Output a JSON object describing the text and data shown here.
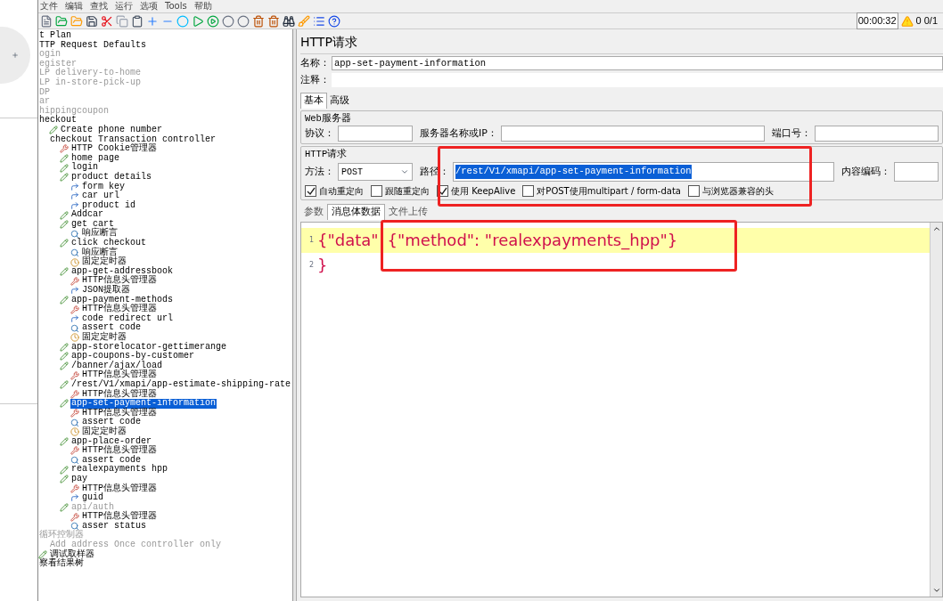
{
  "menu": [
    "文件",
    "编辑",
    "查找",
    "运行",
    "选项",
    "Tools",
    "帮助"
  ],
  "toolbar": {
    "elapsed": "00:00:32",
    "warnings": "0",
    "threads": "0/1"
  },
  "tree": [
    {
      "label": "t Plan",
      "kind": "plan",
      "disabled": false,
      "selected": false
    },
    {
      "label": "TTP Request Defaults",
      "kind": "plain",
      "disabled": false,
      "selected": false
    },
    {
      "label": "ogin",
      "kind": "plain",
      "disabled": true,
      "selected": false
    },
    {
      "label": "egister",
      "kind": "plain",
      "disabled": true,
      "selected": false
    },
    {
      "label": "LP delivery-to-home",
      "kind": "plain",
      "disabled": true,
      "selected": false
    },
    {
      "label": "LP in-store-pick-up",
      "kind": "plain",
      "disabled": true,
      "selected": false
    },
    {
      "label": "DP",
      "kind": "plain",
      "disabled": true,
      "selected": false
    },
    {
      "label": "ar",
      "kind": "plain",
      "disabled": true,
      "selected": false
    },
    {
      "label": "hippingcoupon",
      "kind": "plain",
      "disabled": true,
      "selected": false
    },
    {
      "label": "heckout",
      "kind": "plain",
      "disabled": false,
      "selected": false,
      "children": [
        {
          "label": "Create phone number",
          "kind": "sampler",
          "disabled": false,
          "selected": false
        },
        {
          "label": "checkout Transaction controller",
          "kind": "controller",
          "disabled": false,
          "selected": false,
          "children": [
            {
              "label": "HTTP Cookie管理器",
              "kind": "config",
              "disabled": false,
              "selected": false
            },
            {
              "label": "home page",
              "kind": "sampler",
              "disabled": false,
              "selected": false
            },
            {
              "label": "login",
              "kind": "sampler",
              "disabled": false,
              "selected": false
            },
            {
              "label": "product details",
              "kind": "sampler",
              "disabled": false,
              "selected": false,
              "children": [
                {
                  "label": "form key",
                  "kind": "extractor",
                  "disabled": false,
                  "selected": false
                },
                {
                  "label": "car url",
                  "kind": "extractor",
                  "disabled": false,
                  "selected": false
                },
                {
                  "label": "product id",
                  "kind": "extractor",
                  "disabled": false,
                  "selected": false
                }
              ]
            },
            {
              "label": "Addcar",
              "kind": "sampler",
              "disabled": false,
              "selected": false
            },
            {
              "label": "get cart",
              "kind": "sampler",
              "disabled": false,
              "selected": false,
              "children": [
                {
                  "label": "响应断言",
                  "kind": "assertion",
                  "disabled": false,
                  "selected": false
                }
              ]
            },
            {
              "label": "click checkout",
              "kind": "sampler",
              "disabled": false,
              "selected": false,
              "children": [
                {
                  "label": "响应断言",
                  "kind": "assertion",
                  "disabled": false,
                  "selected": false
                },
                {
                  "label": "固定定时器",
                  "kind": "timer",
                  "disabled": false,
                  "selected": false
                }
              ]
            },
            {
              "label": "app-get-addressbook",
              "kind": "sampler",
              "disabled": false,
              "selected": false,
              "children": [
                {
                  "label": "HTTP信息头管理器",
                  "kind": "config",
                  "disabled": false,
                  "selected": false
                },
                {
                  "label": "JSON提取器",
                  "kind": "extractor",
                  "disabled": false,
                  "selected": false
                }
              ]
            },
            {
              "label": "app-payment-methods",
              "kind": "sampler",
              "disabled": false,
              "selected": false,
              "children": [
                {
                  "label": "HTTP信息头管理器",
                  "kind": "config",
                  "disabled": false,
                  "selected": false
                },
                {
                  "label": "code redirect url",
                  "kind": "extractor",
                  "disabled": false,
                  "selected": false
                },
                {
                  "label": "assert code",
                  "kind": "assertion",
                  "disabled": false,
                  "selected": false
                },
                {
                  "label": "固定定时器",
                  "kind": "timer",
                  "disabled": false,
                  "selected": false
                }
              ]
            },
            {
              "label": "app-storelocator-gettimerange",
              "kind": "sampler",
              "disabled": false,
              "selected": false
            },
            {
              "label": "app-coupons-by-customer",
              "kind": "sampler",
              "disabled": false,
              "selected": false
            },
            {
              "label": "/banner/ajax/load",
              "kind": "sampler",
              "disabled": false,
              "selected": false,
              "children": [
                {
                  "label": "HTTP信息头管理器",
                  "kind": "config",
                  "disabled": false,
                  "selected": false
                }
              ]
            },
            {
              "label": "/rest/V1/xmapi/app-estimate-shipping-rate",
              "kind": "sampler",
              "disabled": false,
              "selected": false,
              "children": [
                {
                  "label": "HTTP信息头管理器",
                  "kind": "config",
                  "disabled": false,
                  "selected": false
                }
              ]
            },
            {
              "label": "app-set-payment-information",
              "kind": "sampler",
              "disabled": false,
              "selected": true,
              "children": [
                {
                  "label": "HTTP信息头管理器",
                  "kind": "config",
                  "disabled": false,
                  "selected": false
                },
                {
                  "label": "assert code",
                  "kind": "assertion",
                  "disabled": false,
                  "selected": false
                },
                {
                  "label": "固定定时器",
                  "kind": "timer",
                  "disabled": false,
                  "selected": false
                }
              ]
            },
            {
              "label": "app-place-order",
              "kind": "sampler",
              "disabled": false,
              "selected": false,
              "children": [
                {
                  "label": "HTTP信息头管理器",
                  "kind": "config",
                  "disabled": false,
                  "selected": false
                },
                {
                  "label": "assert code",
                  "kind": "assertion",
                  "disabled": false,
                  "selected": false
                }
              ]
            },
            {
              "label": "realexpayments hpp",
              "kind": "sampler",
              "disabled": false,
              "selected": false
            },
            {
              "label": "pay",
              "kind": "sampler",
              "disabled": false,
              "selected": false,
              "children": [
                {
                  "label": "HTTP信息头管理器",
                  "kind": "config",
                  "disabled": false,
                  "selected": false
                },
                {
                  "label": "guid",
                  "kind": "extractor",
                  "disabled": false,
                  "selected": false
                }
              ]
            },
            {
              "label": "api/auth",
              "kind": "sampler",
              "disabled": true,
              "selected": false,
              "children": [
                {
                  "label": "HTTP信息头管理器",
                  "kind": "config",
                  "disabled": false,
                  "selected": false
                },
                {
                  "label": "asser status",
                  "kind": "assertion",
                  "disabled": false,
                  "selected": false
                }
              ]
            }
          ]
        }
      ]
    },
    {
      "label": "循环控制器",
      "kind": "controller",
      "disabled": true,
      "selected": false,
      "children": [
        {
          "label": "Add address Once controller only",
          "kind": "controller",
          "disabled": true,
          "selected": false
        }
      ]
    },
    {
      "label": "调试取样器",
      "kind": "sampler",
      "disabled": false,
      "selected": false
    },
    {
      "label": "察看结果树",
      "kind": "plain",
      "disabled": false,
      "selected": false
    }
  ],
  "panel": {
    "title": "HTTP请求",
    "name_label": "名称：",
    "name_value": "app-set-payment-information",
    "comment_label": "注释：",
    "tabs": [
      {
        "label": "基本",
        "selected": true
      },
      {
        "label": "高级",
        "selected": false
      }
    ],
    "web_server": {
      "legend": "Web服务器",
      "protocol_label": "协议：",
      "server_label": "服务器名称或IP：",
      "port_label": "端口号："
    },
    "http_request": {
      "legend": "HTTP请求",
      "method_label": "方法：",
      "method": "POST",
      "path_label": "路径：",
      "path": "/rest/V1/xmapi/app-set-payment-information",
      "encoding_label": "内容编码：",
      "options": [
        {
          "label": "自动重定向",
          "checked": true
        },
        {
          "label": "跟随重定向",
          "checked": false
        },
        {
          "label": "使用 KeepAlive",
          "checked": true
        },
        {
          "label": "对POST使用multipart / form-data",
          "checked": false
        },
        {
          "label": "与浏览器兼容的头",
          "checked": false
        }
      ]
    },
    "body_tabs": [
      {
        "label": "参数",
        "selected": false
      },
      {
        "label": "消息体数据",
        "selected": true
      },
      {
        "label": "文件上传",
        "selected": false
      }
    ],
    "editor": [
      {
        "number": "1",
        "tokens": [
          "{\"data\"",
          "{\"method\": \"realexpayments_hpp\"}"
        ],
        "highlighted": true
      },
      {
        "number": "2",
        "tokens": [
          "}"
        ],
        "highlighted": false
      }
    ]
  }
}
